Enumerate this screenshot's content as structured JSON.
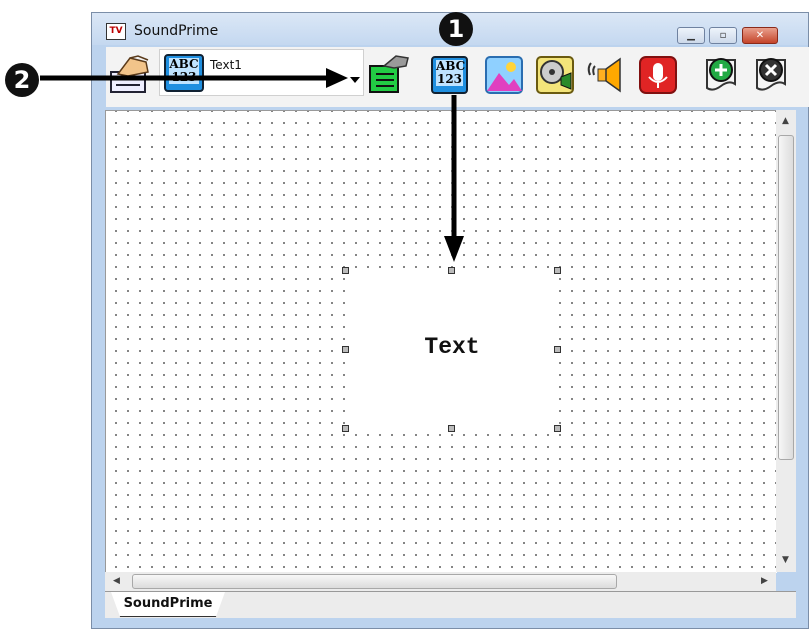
{
  "window": {
    "title": "SoundPrime",
    "app_icon_text": "TV"
  },
  "toolbar": {
    "combo_value": "Text1",
    "text_icon_top": "ABC",
    "text_icon_bottom": "123",
    "icons": [
      "edit-hand-icon",
      "text-abc-icon",
      "dropdown-arrow-icon",
      "object-list-icon",
      "text-abc-icon",
      "image-icon",
      "video-icon",
      "sound-icon",
      "microphone-icon",
      "add-page-icon",
      "delete-page-icon"
    ]
  },
  "canvas": {
    "text_object_label": "Text"
  },
  "tabs": [
    {
      "label": "SoundPrime"
    }
  ],
  "callouts": {
    "one": "1",
    "two": "2"
  },
  "colors": {
    "accent": "#1f8fe0",
    "close": "#c4442a",
    "add": "#2e9a3a",
    "record": "#d02020"
  }
}
